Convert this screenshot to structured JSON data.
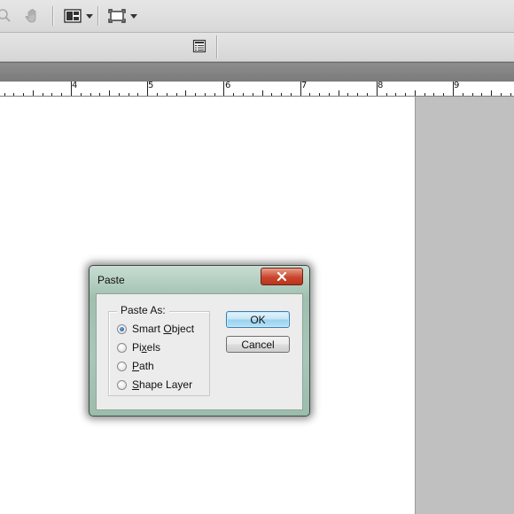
{
  "toolbar": {
    "icons": [
      "zoom-icon",
      "hand-icon",
      "arrange-documents-icon",
      "screen-mode-icon",
      "panel-menu-icon"
    ]
  },
  "ruler": {
    "labels": [
      "4",
      "5",
      "6",
      "7",
      "8",
      "9"
    ]
  },
  "dialog": {
    "title": "Paste",
    "group_label": "Paste As:",
    "options": [
      {
        "pre": "Smart ",
        "accel": "O",
        "post": "bject",
        "checked": true
      },
      {
        "pre": "Pi",
        "accel": "x",
        "post": "els",
        "checked": false
      },
      {
        "pre": "",
        "accel": "P",
        "post": "ath",
        "checked": false
      },
      {
        "pre": "",
        "accel": "S",
        "post": "hape Layer",
        "checked": false
      }
    ],
    "ok_label": "OK",
    "cancel_label": "Cancel"
  }
}
